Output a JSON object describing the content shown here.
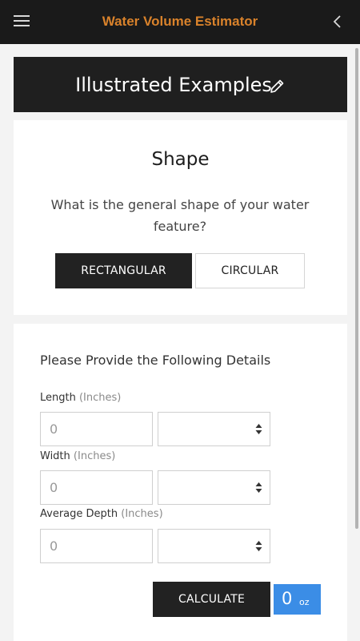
{
  "app": {
    "title": "Water Volume Estimator"
  },
  "banner": {
    "title": "Illustrated Examples"
  },
  "shape_section": {
    "title": "Shape",
    "question": "What is the general shape of your water feature?",
    "options": [
      {
        "label": "RECTANGULAR",
        "selected": true
      },
      {
        "label": "CIRCULAR",
        "selected": false
      }
    ]
  },
  "details_section": {
    "heading": "Please Provide the Following Details",
    "fields": [
      {
        "label": "Length",
        "unit": "(Inches)",
        "value": "0",
        "unit_select": ""
      },
      {
        "label": "Width",
        "unit": "(Inches)",
        "value": "0",
        "unit_select": ""
      },
      {
        "label": "Average Depth",
        "unit": "(Inches)",
        "value": "0",
        "unit_select": ""
      }
    ],
    "calculate_label": "CALCULATE",
    "result": {
      "value": "0",
      "unit": "oz"
    }
  },
  "colors": {
    "app_title": "#d9822b",
    "appbar_bg": "#1a1a1a",
    "banner_bg": "#1f1f1f",
    "selected_option_bg": "#222222",
    "result_bg": "#3b8de6"
  },
  "icons": {
    "menu": "hamburger-icon",
    "back": "chevron-left-icon",
    "edit": "pencil-icon",
    "select": "sort-caret-icon"
  }
}
